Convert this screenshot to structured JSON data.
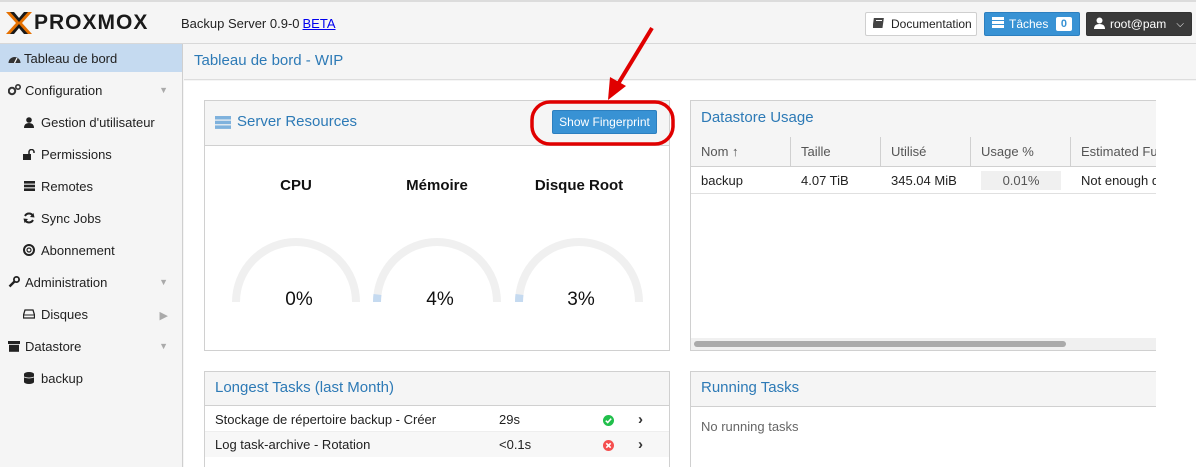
{
  "header": {
    "product_name": "PROXMOX",
    "version_text": "Backup Server 0.9-0",
    "beta_label": "BETA",
    "documentation_label": "Documentation",
    "tasks_label": "Tâches",
    "tasks_count": "0",
    "user_label": "root@pam"
  },
  "sidebar": {
    "items": [
      {
        "label": "Tableau de bord",
        "icon": "dashboard-icon"
      },
      {
        "label": "Configuration",
        "icon": "gears-icon"
      },
      {
        "label": "Gestion d'utilisateur",
        "icon": "user-icon"
      },
      {
        "label": "Permissions",
        "icon": "unlock-icon"
      },
      {
        "label": "Remotes",
        "icon": "server-icon"
      },
      {
        "label": "Sync Jobs",
        "icon": "refresh-icon"
      },
      {
        "label": "Abonnement",
        "icon": "support-icon"
      },
      {
        "label": "Administration",
        "icon": "wrench-icon"
      },
      {
        "label": "Disques",
        "icon": "hdd-icon"
      },
      {
        "label": "Datastore",
        "icon": "archive-icon"
      },
      {
        "label": "backup",
        "icon": "database-icon"
      }
    ]
  },
  "main": {
    "title": "Tableau de bord - WIP"
  },
  "server_resources": {
    "title": "Server Resources",
    "fingerprint_button": "Show Fingerprint",
    "gauges": [
      {
        "label": "CPU",
        "value_text": "0%",
        "value": 0
      },
      {
        "label": "Mémoire",
        "value_text": "4%",
        "value": 4
      },
      {
        "label": "Disque Root",
        "value_text": "3%",
        "value": 3
      }
    ]
  },
  "datastore_usage": {
    "title": "Datastore Usage",
    "columns": [
      "Nom ↑",
      "Taille",
      "Utilisé",
      "Usage %",
      "Estimated Fu"
    ],
    "rows": [
      {
        "name": "backup",
        "size": "4.07 TiB",
        "used": "345.04 MiB",
        "usage": "0.01%",
        "estimated": "Not enough d"
      }
    ]
  },
  "longest_tasks": {
    "title": "Longest Tasks (last Month)",
    "rows": [
      {
        "name": "Stockage de répertoire backup - Créer",
        "duration": "29s",
        "status": "ok"
      },
      {
        "name": "Log task-archive - Rotation",
        "duration": "<0.1s",
        "status": "error"
      }
    ]
  },
  "running_tasks": {
    "title": "Running Tasks",
    "empty_text": "No running tasks"
  },
  "colors": {
    "accent": "#3892d4",
    "title_blue": "#2d7ab6",
    "annotation_red": "#e00000"
  }
}
